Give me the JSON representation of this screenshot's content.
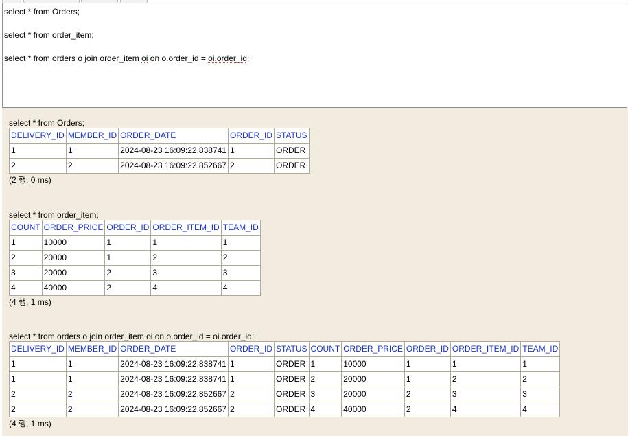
{
  "editor": {
    "lines": [
      "select * from Orders;",
      "",
      "select * from order_item;",
      "",
      "select * from orders o join order_item "
    ],
    "line5_part_oi": "oi",
    "line5_part_mid": " on o.order_id = ",
    "line5_part_oiorder": "oi.order_id",
    "line5_part_end": ";"
  },
  "results": [
    {
      "query": "select * from Orders;",
      "columns": [
        "DELIVERY_ID",
        "MEMBER_ID",
        "ORDER_DATE",
        "ORDER_ID",
        "STATUS"
      ],
      "rows": [
        [
          "1",
          "1",
          "2024-08-23 16:09:22.838741",
          "1",
          "ORDER"
        ],
        [
          "2",
          "2",
          "2024-08-23 16:09:22.852667",
          "2",
          "ORDER"
        ]
      ],
      "summary": "(2 행, 0 ms)"
    },
    {
      "query": "select * from order_item;",
      "columns": [
        "COUNT",
        "ORDER_PRICE",
        "ORDER_ID",
        "ORDER_ITEM_ID",
        "TEAM_ID"
      ],
      "rows": [
        [
          "1",
          "10000",
          "1",
          "1",
          "1"
        ],
        [
          "2",
          "20000",
          "1",
          "2",
          "2"
        ],
        [
          "3",
          "20000",
          "2",
          "3",
          "3"
        ],
        [
          "4",
          "40000",
          "2",
          "4",
          "4"
        ]
      ],
      "summary": "(4 행, 1 ms)"
    },
    {
      "query": "select * from orders o join order_item oi on o.order_id = oi.order_id;",
      "columns": [
        "DELIVERY_ID",
        "MEMBER_ID",
        "ORDER_DATE",
        "ORDER_ID",
        "STATUS",
        "COUNT",
        "ORDER_PRICE",
        "ORDER_ID",
        "ORDER_ITEM_ID",
        "TEAM_ID"
      ],
      "rows": [
        [
          "1",
          "1",
          "2024-08-23 16:09:22.838741",
          "1",
          "ORDER",
          "1",
          "10000",
          "1",
          "1",
          "1"
        ],
        [
          "1",
          "1",
          "2024-08-23 16:09:22.838741",
          "1",
          "ORDER",
          "2",
          "20000",
          "1",
          "2",
          "2"
        ],
        [
          "2",
          "2",
          "2024-08-23 16:09:22.852667",
          "2",
          "ORDER",
          "3",
          "20000",
          "2",
          "3",
          "3"
        ],
        [
          "2",
          "2",
          "2024-08-23 16:09:22.852667",
          "2",
          "ORDER",
          "4",
          "40000",
          "2",
          "4",
          "4"
        ]
      ],
      "summary": "(4 행, 1 ms)"
    }
  ]
}
